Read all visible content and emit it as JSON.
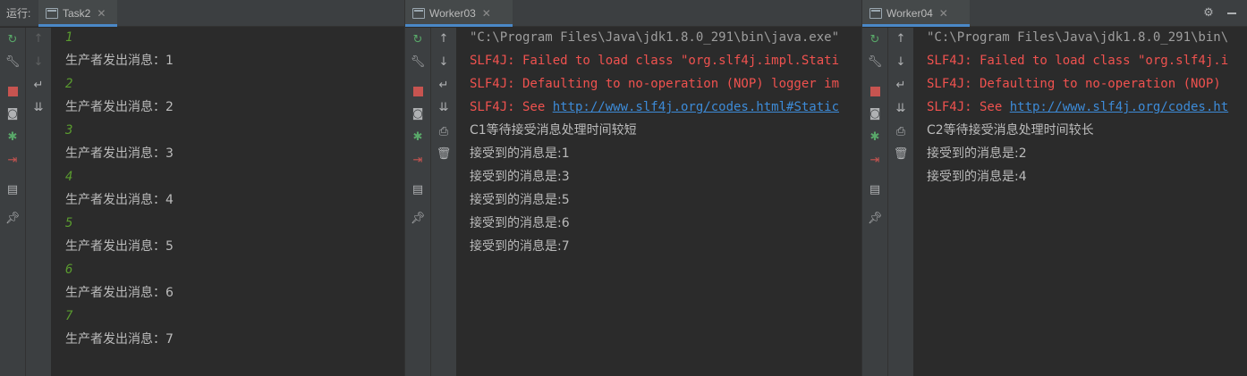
{
  "run_label": "运行:",
  "panels": [
    {
      "tab": "Task2",
      "lines": [
        "1",
        "生产者发出消息：1",
        "2",
        "生产者发出消息：2",
        "3",
        "生产者发出消息：3",
        "4",
        "生产者发出消息：4",
        "5",
        "生产者发出消息：5",
        "6",
        "生产者发出消息：6",
        "7",
        "生产者发出消息：7"
      ]
    },
    {
      "tab": "Worker03",
      "cmd": "\"C:\\Program Files\\Java\\jdk1.8.0_291\\bin\\java.exe\"",
      "err1": "SLF4J: Failed to load class \"org.slf4j.impl.Stati",
      "err2": "SLF4J: Defaulting to no-operation (NOP) logger im",
      "err3_prefix": "SLF4J: See ",
      "err3_link": "http://www.slf4j.org/codes.html#Static",
      "lines": [
        "C1等待接受消息处理时间较短",
        "接受到的消息是:1",
        "接受到的消息是:3",
        "接受到的消息是:5",
        "接受到的消息是:6",
        "接受到的消息是:7"
      ]
    },
    {
      "tab": "Worker04",
      "cmd": "\"C:\\Program Files\\Java\\jdk1.8.0_291\\bin\\",
      "err1": "SLF4J: Failed to load class \"org.slf4j.i",
      "err2": "SLF4J: Defaulting to no-operation (NOP)",
      "err3_prefix": "SLF4J: See ",
      "err3_link": "http://www.slf4j.org/codes.ht",
      "lines": [
        "C2等待接受消息处理时间较长",
        "接受到的消息是:2",
        "接受到的消息是:4"
      ]
    }
  ],
  "icons": [
    "rerun-icon",
    "wrench-icon",
    "stop-icon",
    "camera-icon",
    "debug-icon",
    "exit-icon",
    "layout-icon",
    "pin-icon",
    "up-arrow-icon",
    "down-arrow-icon",
    "soft-wrap-icon",
    "scroll-to-end-icon",
    "print-icon",
    "trash-icon",
    "settings-gear-icon"
  ],
  "colors": {
    "accent": "#4a88c7",
    "error": "#f0524f",
    "number": "#5a9b2f",
    "link": "#3d8bd8"
  }
}
